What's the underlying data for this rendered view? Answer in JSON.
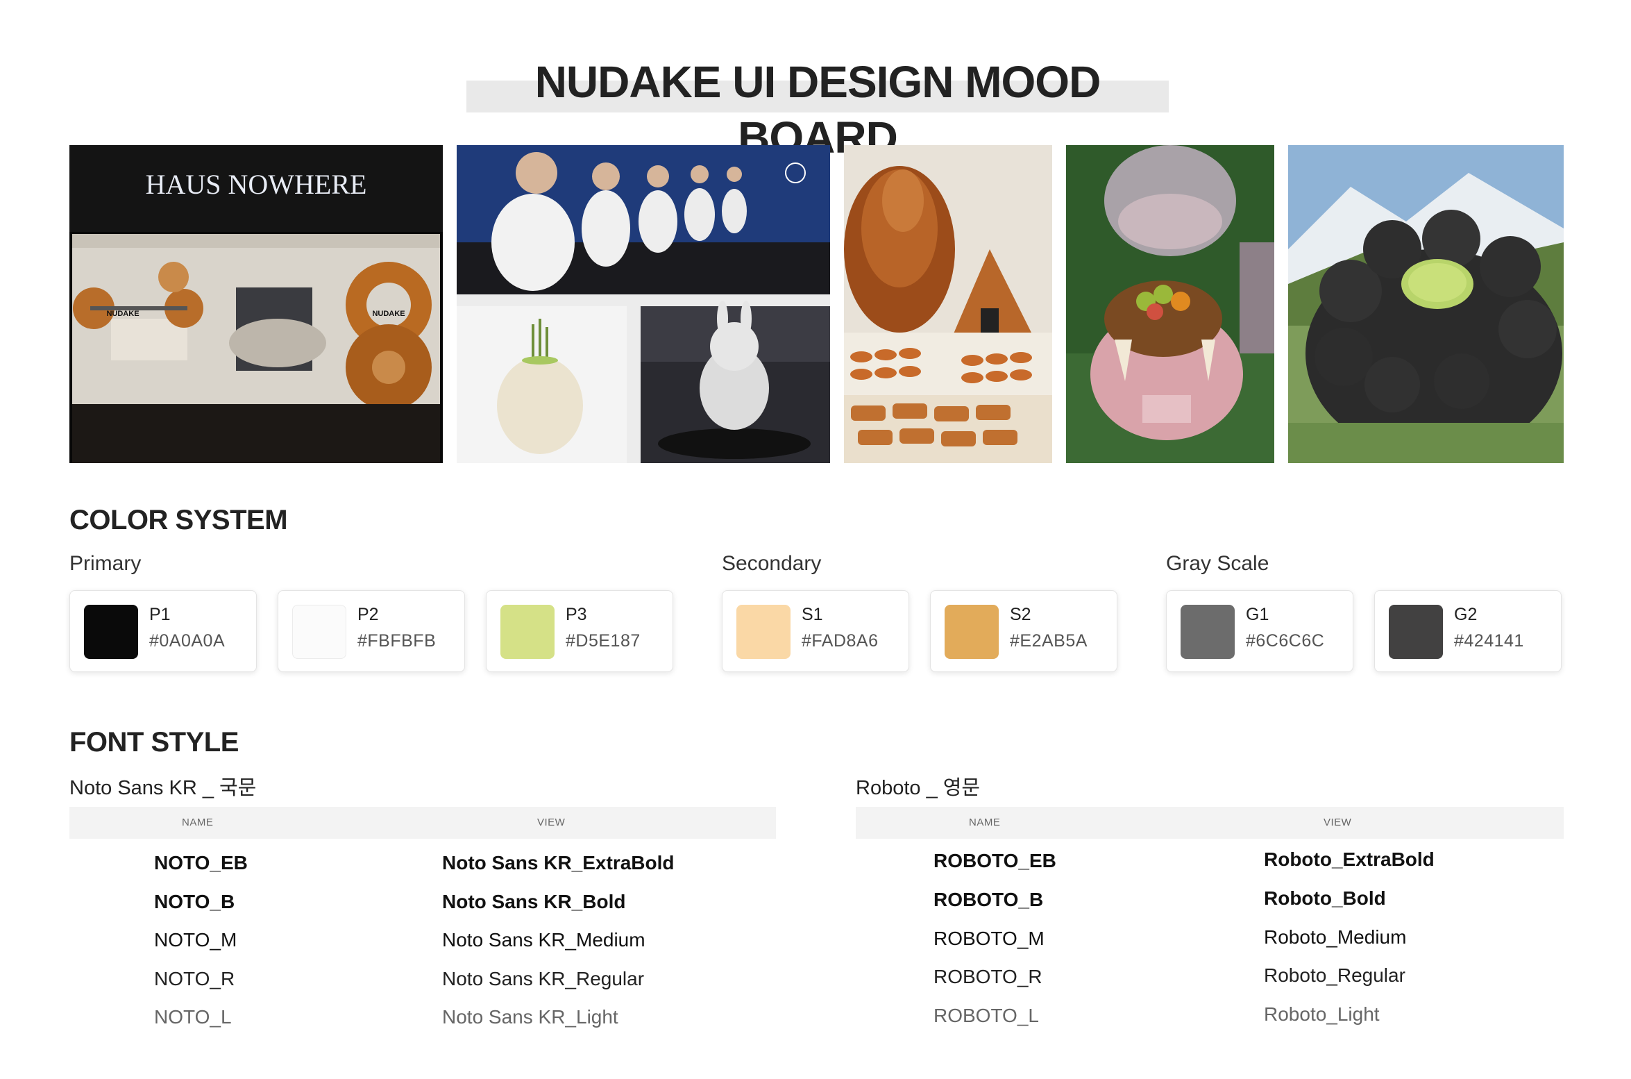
{
  "title": "NUDAKE UI DESIGN MOOD BOARD",
  "mood_images": [
    {
      "name": "haus-nowhere-storefront",
      "sign_text": "HAUS NOWHERE",
      "label_left": "NUDAKE",
      "label_right": "NUDAKE"
    },
    {
      "name": "robots-collage"
    },
    {
      "name": "pastry-display"
    },
    {
      "name": "hippo-cake"
    },
    {
      "name": "black-croissant-mountain"
    }
  ],
  "color_system": {
    "heading": "COLOR SYSTEM",
    "groups": [
      {
        "label": "Primary",
        "colors": [
          {
            "code": "P1",
            "hex": "#0A0A0A"
          },
          {
            "code": "P2",
            "hex": "#FBFBFB"
          },
          {
            "code": "P3",
            "hex": "#D5E187"
          }
        ]
      },
      {
        "label": "Secondary",
        "colors": [
          {
            "code": "S1",
            "hex": "#FAD8A6"
          },
          {
            "code": "S2",
            "hex": "#E2AB5A"
          }
        ]
      },
      {
        "label": "Gray Scale",
        "colors": [
          {
            "code": "G1",
            "hex": "#6C6C6C"
          },
          {
            "code": "G2",
            "hex": "#424141"
          }
        ]
      }
    ]
  },
  "font_style": {
    "heading": "FONT STYLE",
    "tables": [
      {
        "label": "Noto Sans KR _ 국문",
        "col_name": "NAME",
        "col_view": "VIEW",
        "rows": [
          {
            "name": "NOTO_EB",
            "view": "Noto Sans KR_ExtraBold"
          },
          {
            "name": "NOTO_B",
            "view": "Noto Sans KR_Bold"
          },
          {
            "name": "NOTO_M",
            "view": "Noto Sans KR_Medium"
          },
          {
            "name": "NOTO_R",
            "view": "Noto Sans KR_Regular"
          },
          {
            "name": "NOTO_L",
            "view": "Noto Sans KR_Light"
          }
        ]
      },
      {
        "label": "Roboto _ 영문",
        "col_name": "NAME",
        "col_view": "VIEW",
        "rows": [
          {
            "name": "ROBOTO_EB",
            "view": "Roboto_ExtraBold"
          },
          {
            "name": "ROBOTO_B",
            "view": "Roboto_Bold"
          },
          {
            "name": "ROBOTO_M",
            "view": "Roboto_Medium"
          },
          {
            "name": "ROBOTO_R",
            "view": "Roboto_Regular"
          },
          {
            "name": "ROBOTO_L",
            "view": "Roboto_Light"
          }
        ]
      }
    ]
  }
}
